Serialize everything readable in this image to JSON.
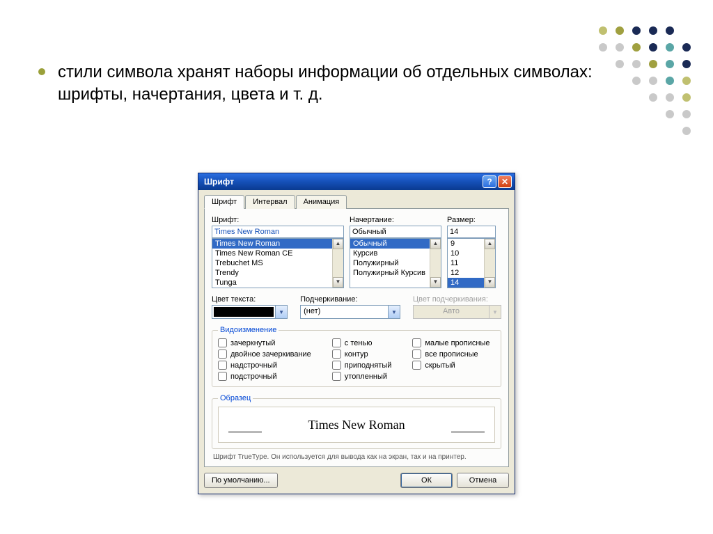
{
  "slide": {
    "bullet": "стили символа хранят наборы информации об отдельных символах: шрифты, начертания, цвета и т. д."
  },
  "dialog": {
    "title": "Шрифт",
    "tabs": {
      "font": "Шрифт",
      "interval": "Интервал",
      "animation": "Анимация"
    },
    "labels": {
      "font": "Шрифт:",
      "style": "Начертание:",
      "size": "Размер:",
      "textColor": "Цвет текста:",
      "underline": "Подчеркивание:",
      "underlineColor": "Цвет подчеркивания:"
    },
    "font": {
      "value": "Times New Roman",
      "list": [
        "Times New Roman",
        "Times New Roman CE",
        "Trebuchet MS",
        "Trendy",
        "Tunga"
      ]
    },
    "style": {
      "value": "Обычный",
      "list": [
        "Обычный",
        "Курсив",
        "Полужирный",
        "Полужирный Курсив"
      ]
    },
    "size": {
      "value": "14",
      "list": [
        "9",
        "10",
        "11",
        "12",
        "14"
      ]
    },
    "underline": {
      "value": "(нет)"
    },
    "underlineColor": {
      "value": "Авто"
    },
    "effectsLegend": "Видоизменение",
    "effects": {
      "col1": [
        "зачеркнутый",
        "двойное зачеркивание",
        "надстрочный",
        "подстрочный"
      ],
      "col2": [
        "с тенью",
        "контур",
        "приподнятый",
        "утопленный"
      ],
      "col3": [
        "малые прописные",
        "все прописные",
        "скрытый"
      ]
    },
    "sampleLegend": "Образец",
    "sampleText": "Times New Roman",
    "hint": "Шрифт TrueType. Он используется для вывода как на экран, так и на принтер.",
    "buttons": {
      "default": "По умолчанию...",
      "ok": "ОК",
      "cancel": "Отмена"
    }
  }
}
